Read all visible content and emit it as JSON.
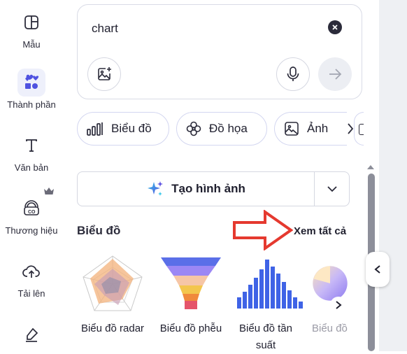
{
  "rail": {
    "items": [
      {
        "label": "Mẫu",
        "icon": "template-icon"
      },
      {
        "label": "Thành phần",
        "icon": "elements-icon"
      },
      {
        "label": "Văn bản",
        "icon": "text-icon"
      },
      {
        "label": "Thương hiệu",
        "icon": "brand-icon"
      },
      {
        "label": "Tải lên",
        "icon": "upload-icon"
      }
    ]
  },
  "search": {
    "value": "chart"
  },
  "chips": [
    {
      "label": "Biểu đồ",
      "icon": "bar-chart-icon"
    },
    {
      "label": "Đồ họa",
      "icon": "graphics-icon"
    },
    {
      "label": "Ảnh",
      "icon": "image-icon"
    }
  ],
  "generate": {
    "label": "Tạo hình ảnh"
  },
  "section": {
    "title": "Biểu đồ",
    "see_all": "Xem tất cả",
    "items": [
      {
        "label": "Biểu đồ radar"
      },
      {
        "label": "Biểu đồ phễu"
      },
      {
        "label": "Biểu đồ tần suất"
      },
      {
        "label": "Biểu đồ"
      }
    ]
  },
  "colors": {
    "accent": "#4f52e0",
    "annotation_arrow": "#e5392f"
  }
}
